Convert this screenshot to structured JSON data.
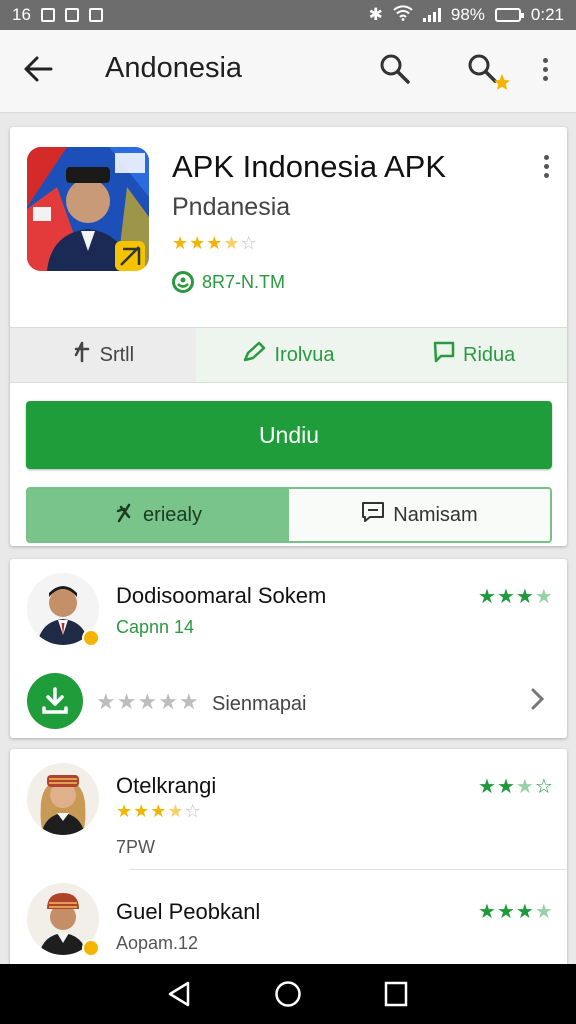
{
  "status_bar": {
    "left_text": "16",
    "battery_percent": "98%",
    "time": "0:21"
  },
  "app_bar": {
    "title": "Andonesia"
  },
  "app_card": {
    "title": "APK Indonesia APK",
    "developer": "Pndanesia",
    "rating_stars": 3.5,
    "badge_text": "8R7-N.TM",
    "actions": [
      {
        "label": "Srtll"
      },
      {
        "label": "Irolvua"
      },
      {
        "label": "Ridua"
      }
    ],
    "install_label": "Undiu",
    "toggle": [
      {
        "label": "eriealy"
      },
      {
        "label": "Namisam"
      }
    ]
  },
  "card_two": {
    "name": "Dodisoomaral Sokem",
    "sub": "Capnn 14",
    "rating_stars": 3.5,
    "footer_stars": 5,
    "footer_text": "Sienmapai"
  },
  "reviews": [
    {
      "name": "Otelkrangi",
      "rating_stars_orange": 3.5,
      "meta": "7PW",
      "rating_stars_green": 2.5
    },
    {
      "name": "Guel Peobkanl",
      "meta": "Aopam.12",
      "rating_stars_green": 3.5
    }
  ],
  "colors": {
    "accent_green": "#1f9d3a",
    "star_orange": "#f4b400"
  }
}
